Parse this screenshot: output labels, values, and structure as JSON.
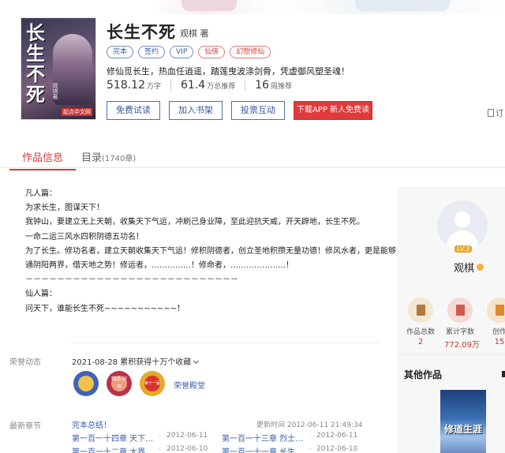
{
  "book": {
    "cover_title": "长生不死",
    "cover_author": "观棋著",
    "cover_brand": "起点中文网",
    "title": "长生不死",
    "author": "观棋 著",
    "tags": [
      "完本",
      "签约",
      "VIP",
      "仙侠",
      "幻想修仙"
    ],
    "intro": "修仙觅长生，热血任逍遥，踏莲曳波涤剑骨，凭虚御风塑圣魂！",
    "stats": [
      {
        "num": "518.12",
        "unit": "万字"
      },
      {
        "num": "61.4",
        "unit": "万总推荐"
      },
      {
        "num": "16",
        "unit": "周推荐"
      }
    ],
    "buttons": {
      "trial": "免费试读",
      "add_shelf": "加入书架",
      "vote": "投票互动",
      "download": "下载APP 新人免费读"
    },
    "subscribe": "订"
  },
  "tabs": {
    "info": "作品信息",
    "catalog": "目录",
    "catalog_count": "(1740章)"
  },
  "description": [
    "凡人篇：",
    "为求长生，图谋天下！",
    "我钟山，要建立无上天朝，收集天下气运，冲刷己身业障，至此迎抗天威，开天辟地，长生不死。",
    "一命二运三风水四积阴德五功名！",
    "为了长生。修功名者，建立天朝收集天下气运！修积阴德者，创立圣地积攒无量功德！修风水者，更是能够沟",
    "通阴阳两界，借天地之势！修运者，……………！修命者，…………………！",
    "－－－－－－－－－－－－－－－－－－－－－－－－－－－",
    "仙人篇：",
    "问天下，谁能长生不死~~~~~~~~~~~！"
  ],
  "honor": {
    "label": "荣誉动态",
    "entry": "2021-08-28 累积获得十万个收藏",
    "link": "荣誉殿堂",
    "badge_text": [
      "",
      "精品 好书",
      "第十一届"
    ]
  },
  "latest": {
    "label": "最新章节",
    "title": "完本总结！",
    "update_time": "更新时间 2012-06-11 21:49:34",
    "rows": [
      [
        {
          "title": "第一百一十四章 天下…",
          "date": "2012-06-11"
        },
        {
          "title": "第一百一十三章 烈士…",
          "date": "2012-06-11"
        }
      ],
      [
        {
          "title": "第一百一十二章 大界…",
          "date": "2012-06-10"
        },
        {
          "title": "第一百一十一章 长生…",
          "date": "2012-06-10"
        }
      ]
    ]
  },
  "author_panel": {
    "level": "LV.3",
    "name": "观棋",
    "stats": [
      {
        "label": "作品总数",
        "value": "2",
        "color": "#c8a368"
      },
      {
        "label": "累计字数",
        "value": "772.09万",
        "color": "#d9736c"
      },
      {
        "label": "创作",
        "value": "15",
        "color": "#e0a75a"
      }
    ],
    "other_works_title": "其他作品",
    "other_work_cover": "修道生涯"
  }
}
